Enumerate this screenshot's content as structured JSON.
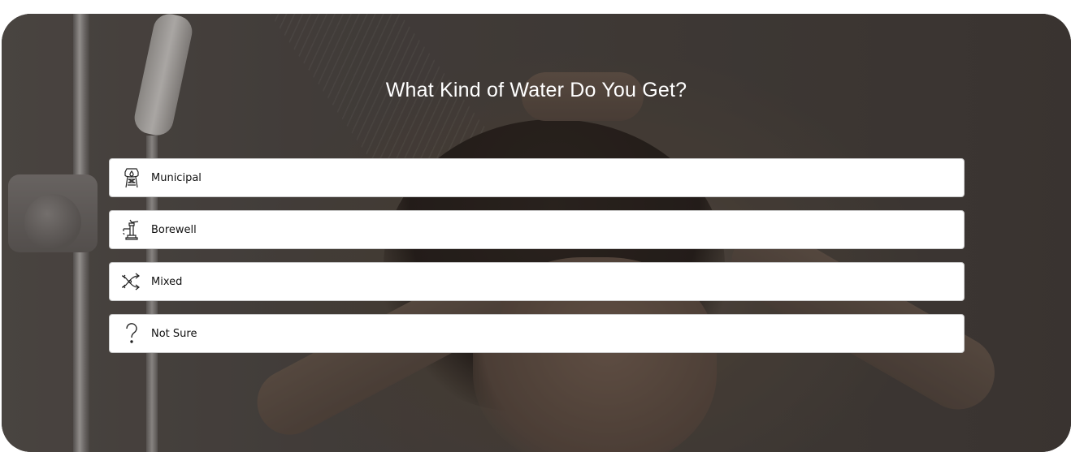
{
  "quiz": {
    "title": "What Kind of Water Do You Get?",
    "options": [
      {
        "label": "Municipal",
        "icon": "water-tower-icon"
      },
      {
        "label": "Borewell",
        "icon": "hand-pump-icon"
      },
      {
        "label": "Mixed",
        "icon": "mixed-arrows-icon"
      },
      {
        "label": "Not Sure",
        "icon": "question-mark-icon"
      }
    ]
  },
  "colors": {
    "option_background": "#ffffff",
    "option_border": "#c9c9c9",
    "title_text": "#ffffff",
    "label_text": "#111111"
  }
}
